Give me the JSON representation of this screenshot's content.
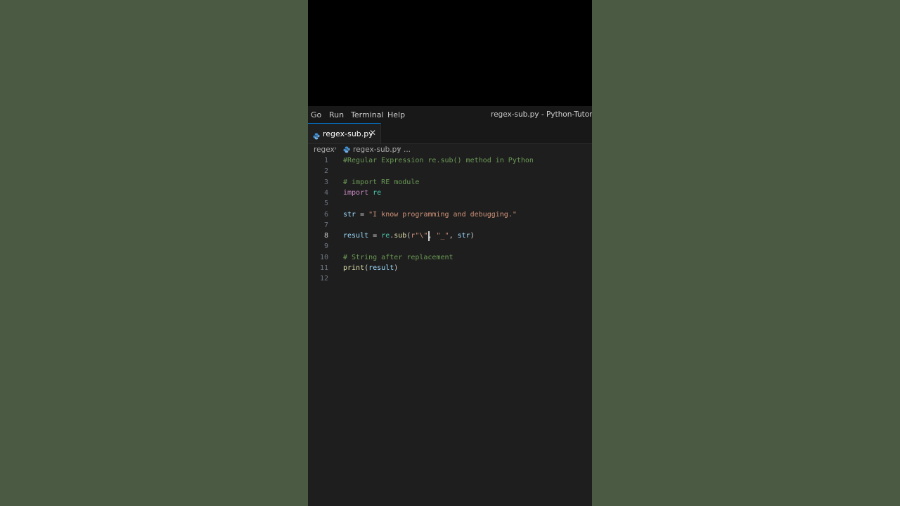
{
  "menu": {
    "items": [
      "Go",
      "Run",
      "Terminal",
      "Help"
    ],
    "window_title": "regex-sub.py - Python-Tutorial - V"
  },
  "tab": {
    "label": "regex-sub.py",
    "close": "✕"
  },
  "breadcrumb": {
    "folder": "regex",
    "file": "regex-sub.py",
    "more": "..."
  },
  "editor": {
    "active_line": 8,
    "lines": [
      {
        "n": "1",
        "segments": [
          {
            "t": "#Regular Expression re.sub() method in Python",
            "c": "comment"
          }
        ]
      },
      {
        "n": "2",
        "segments": []
      },
      {
        "n": "3",
        "segments": [
          {
            "t": "# import RE module",
            "c": "comment"
          }
        ]
      },
      {
        "n": "4",
        "segments": [
          {
            "t": "import",
            "c": "kw"
          },
          {
            "t": " ",
            "c": "op"
          },
          {
            "t": "re",
            "c": "mod"
          }
        ]
      },
      {
        "n": "5",
        "segments": []
      },
      {
        "n": "6",
        "segments": [
          {
            "t": "str",
            "c": "var"
          },
          {
            "t": " = ",
            "c": "op"
          },
          {
            "t": "\"I know programming and debugging.\"",
            "c": "str"
          }
        ]
      },
      {
        "n": "7",
        "segments": []
      },
      {
        "n": "8",
        "segments": [
          {
            "t": "result",
            "c": "var"
          },
          {
            "t": " = ",
            "c": "op"
          },
          {
            "t": "re",
            "c": "mod"
          },
          {
            "t": ".",
            "c": "op"
          },
          {
            "t": "sub",
            "c": "fn"
          },
          {
            "t": "(",
            "c": "op"
          },
          {
            "t": "r\"\\",
            "c": "str"
          },
          {
            "t": "\"",
            "c": "str"
          },
          {
            "t": ", ",
            "c": "op"
          },
          {
            "t": "\"_\"",
            "c": "str"
          },
          {
            "t": ", ",
            "c": "op"
          },
          {
            "t": "str",
            "c": "var"
          },
          {
            "t": ")",
            "c": "op"
          }
        ]
      },
      {
        "n": "9",
        "segments": []
      },
      {
        "n": "10",
        "segments": [
          {
            "t": "# String after replacement",
            "c": "comment"
          }
        ]
      },
      {
        "n": "11",
        "segments": [
          {
            "t": "print",
            "c": "fn"
          },
          {
            "t": "(",
            "c": "op"
          },
          {
            "t": "result",
            "c": "var"
          },
          {
            "t": ")",
            "c": "op"
          }
        ]
      },
      {
        "n": "12",
        "segments": []
      }
    ]
  },
  "colors": {
    "accent": "#0078d4",
    "python_icon": "#3d8fd6",
    "comment": "#6a9955",
    "string": "#ce9178",
    "keyword": "#c586c0"
  },
  "icons": {
    "file": "python-file-icon",
    "breadcrumb_sep": "chevron-right-icon"
  }
}
